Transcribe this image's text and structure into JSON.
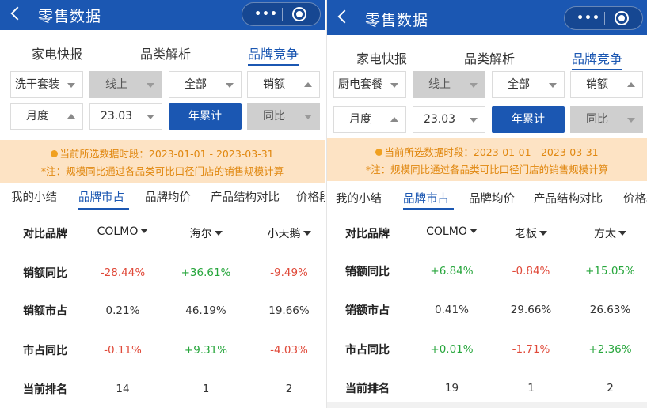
{
  "panels": [
    {
      "nav": {
        "title": "零售数据"
      },
      "top_tabs": [
        "家电快报",
        "品类解析",
        "品牌竞争"
      ],
      "filters": {
        "category": "洗干套装",
        "channel": "线上",
        "region": "全部",
        "metric": "销额",
        "period": "月度",
        "month": "23.03",
        "ytd_label": "年累计",
        "compare": "同比"
      },
      "notice": {
        "period_line": "当前所选数据时段：2023-01-01 - 2023-03-31",
        "note_line": "*注：规模同比通过各品类可比口径门店的销售规模计算"
      },
      "sub_tabs": [
        "我的小结",
        "品牌市占",
        "品牌均价",
        "产品结构对比",
        "价格段"
      ],
      "table": {
        "header_label": "对比品牌",
        "brands": [
          "COLMO",
          "海尔",
          "小天鹅"
        ],
        "rows": [
          {
            "label": "销额同比",
            "values": [
              "-28.44%",
              "+36.61%",
              "-9.49%"
            ]
          },
          {
            "label": "销额市占",
            "values": [
              "0.21%",
              "46.19%",
              "19.66%"
            ]
          },
          {
            "label": "市占同比",
            "values": [
              "-0.11%",
              "+9.31%",
              "-4.03%"
            ]
          },
          {
            "label": "当前排名",
            "values": [
              "14",
              "1",
              "2"
            ]
          }
        ]
      }
    },
    {
      "nav": {
        "title": "零售数据"
      },
      "top_tabs": [
        "家电快报",
        "品类解析",
        "品牌竞争"
      ],
      "filters": {
        "category": "厨电套餐",
        "channel": "线上",
        "region": "全部",
        "metric": "销额",
        "period": "月度",
        "month": "23.03",
        "ytd_label": "年累计",
        "compare": "同比"
      },
      "notice": {
        "period_line": "当前所选数据时段：2023-01-01 - 2023-03-31",
        "note_line": "*注：规模同比通过各品类可比口径门店的销售规模计算"
      },
      "sub_tabs": [
        "我的小结",
        "品牌市占",
        "品牌均价",
        "产品结构对比",
        "价格段"
      ],
      "table": {
        "header_label": "对比品牌",
        "brands": [
          "COLMO",
          "老板",
          "方太"
        ],
        "rows": [
          {
            "label": "销额同比",
            "values": [
              "+6.84%",
              "-0.84%",
              "+15.05%"
            ]
          },
          {
            "label": "销额市占",
            "values": [
              "0.41%",
              "29.66%",
              "26.63%"
            ]
          },
          {
            "label": "市占同比",
            "values": [
              "+0.01%",
              "-1.71%",
              "+2.36%"
            ]
          },
          {
            "label": "当前排名",
            "values": [
              "19",
              "1",
              "2"
            ]
          }
        ]
      }
    }
  ],
  "colors": {
    "brand_blue": "#1b57b2",
    "negative": "#e04a3a",
    "positive": "#27a63c",
    "notice_bg": "#fde3c4",
    "notice_text": "#e0870f"
  }
}
